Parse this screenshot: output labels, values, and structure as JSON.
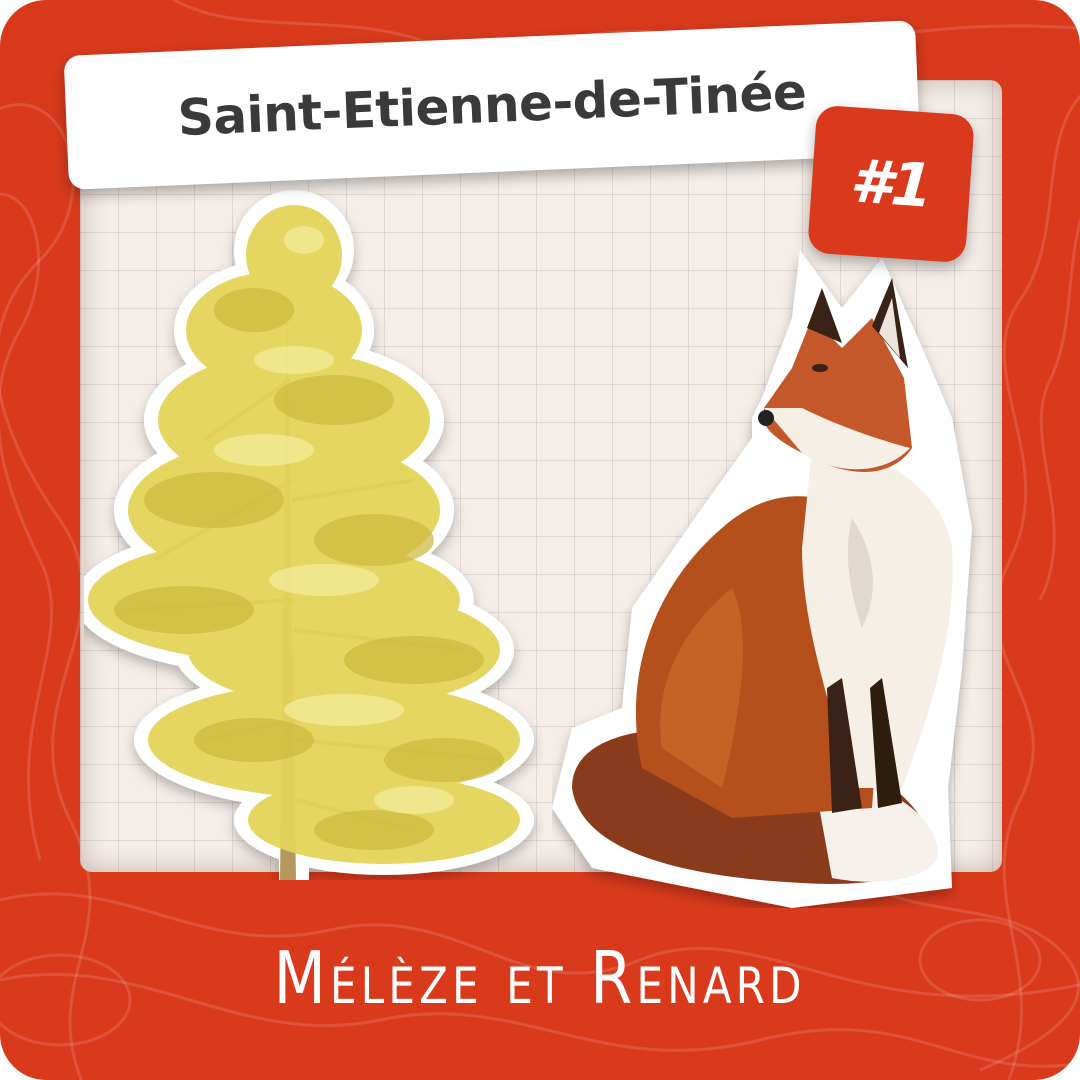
{
  "title": "Saint-Etienne-de-Tinée",
  "badge": "#1",
  "caption": "Mélèze et Renard",
  "illustrations": {
    "left": "larch-tree-illustration",
    "right": "red-fox-illustration"
  },
  "colors": {
    "frame": "#d93a1c",
    "paper": "#f4ede8",
    "title_text": "#3a3a3a",
    "label_background": "#ffffff",
    "caption_text": "#ffffff"
  }
}
